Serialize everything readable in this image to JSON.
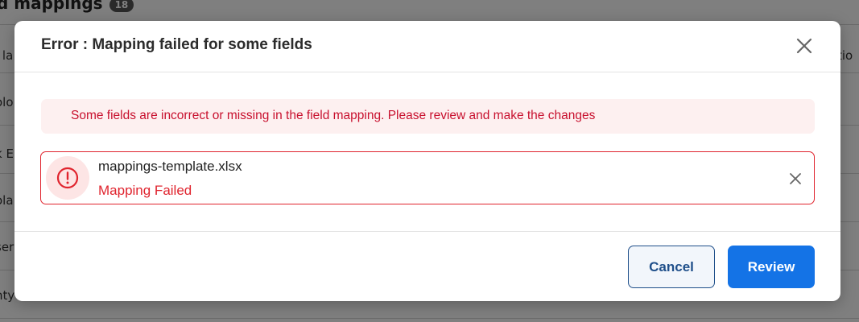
{
  "background": {
    "title": "d mappings",
    "count_badge": "18",
    "left_cells": [
      "l la",
      "olo",
      "k E",
      "ola",
      "ser",
      "nty"
    ],
    "right_header_partial": "tio"
  },
  "modal": {
    "title": "Error : Mapping failed for some fields",
    "close_icon": "close-icon",
    "error_message": "Some fields are incorrect or missing in the field mapping. Please review and make the changes",
    "file": {
      "name": "mappings-template.xlsx",
      "status": "Mapping Failed",
      "status_icon": "alert-circle-icon",
      "remove_icon": "close-icon"
    },
    "actions": {
      "cancel_label": "Cancel",
      "review_label": "Review"
    }
  },
  "colors": {
    "error_red": "#e0242e",
    "error_text": "#c8102e",
    "error_bg": "#fdf0f0",
    "primary_blue": "#1473e6",
    "secondary_navy": "#1f4f8a"
  }
}
